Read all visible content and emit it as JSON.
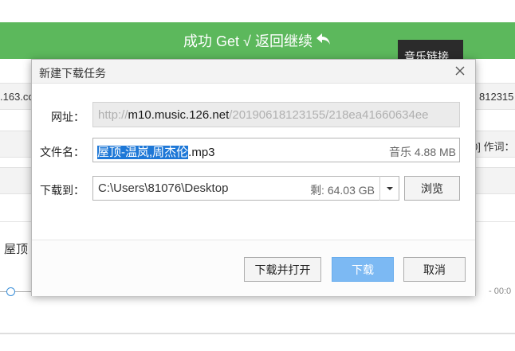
{
  "banner": {
    "text": "成功 Get √ 返回继续",
    "arrow_icon": "reply-arrow-icon"
  },
  "music_link_button": "音乐链接",
  "background": {
    "left_url_fragment": ".163.co",
    "right_url_fragment": "812315",
    "right_lyric_label": "0] 作词：",
    "left_song_fragment": "屋顶",
    "right_time": "- 00:0"
  },
  "dialog": {
    "title": "新建下载任务",
    "url_label": "网址：",
    "url_prefix": "http://",
    "url_host": "m10.music.126.net",
    "url_path": "/20190618123155/218ea41660634ee",
    "filename_label": "文件名：",
    "filename_selected": "屋顶-温岚,周杰伦",
    "filename_ext": ".mp3",
    "file_meta": "音乐 4.88 MB",
    "saveto_label": "下载到：",
    "save_path": "C:\\Users\\81076\\Desktop",
    "free_space": "剩: 64.03 GB",
    "browse_button": "浏览",
    "download_open_button": "下载并打开",
    "download_button": "下载",
    "cancel_button": "取消"
  },
  "colors": {
    "banner_green": "#5cb85c",
    "primary_button": "#7cb9f3",
    "selection": "#1e78d7"
  }
}
